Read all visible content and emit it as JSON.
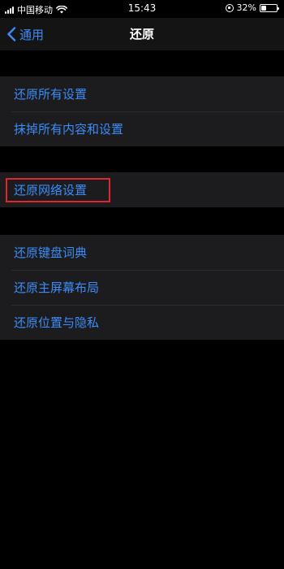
{
  "status_bar": {
    "carrier": "中国移动",
    "time": "15:43",
    "battery_percent": "32%",
    "battery_level": 0.32
  },
  "nav": {
    "back_label": "通用",
    "title": "还原"
  },
  "groups": [
    {
      "items": [
        {
          "label": "还原所有设置"
        },
        {
          "label": "抹掉所有内容和设置"
        }
      ]
    },
    {
      "items": [
        {
          "label": "还原网络设置",
          "highlighted": true
        }
      ]
    },
    {
      "items": [
        {
          "label": "还原键盘词典"
        },
        {
          "label": "还原主屏幕布局"
        },
        {
          "label": "还原位置与隐私"
        }
      ]
    }
  ],
  "colors": {
    "accent": "#3b8cf6",
    "highlight_border": "#e0262d",
    "cell_background": "#1c1c1e",
    "background": "#000000"
  }
}
